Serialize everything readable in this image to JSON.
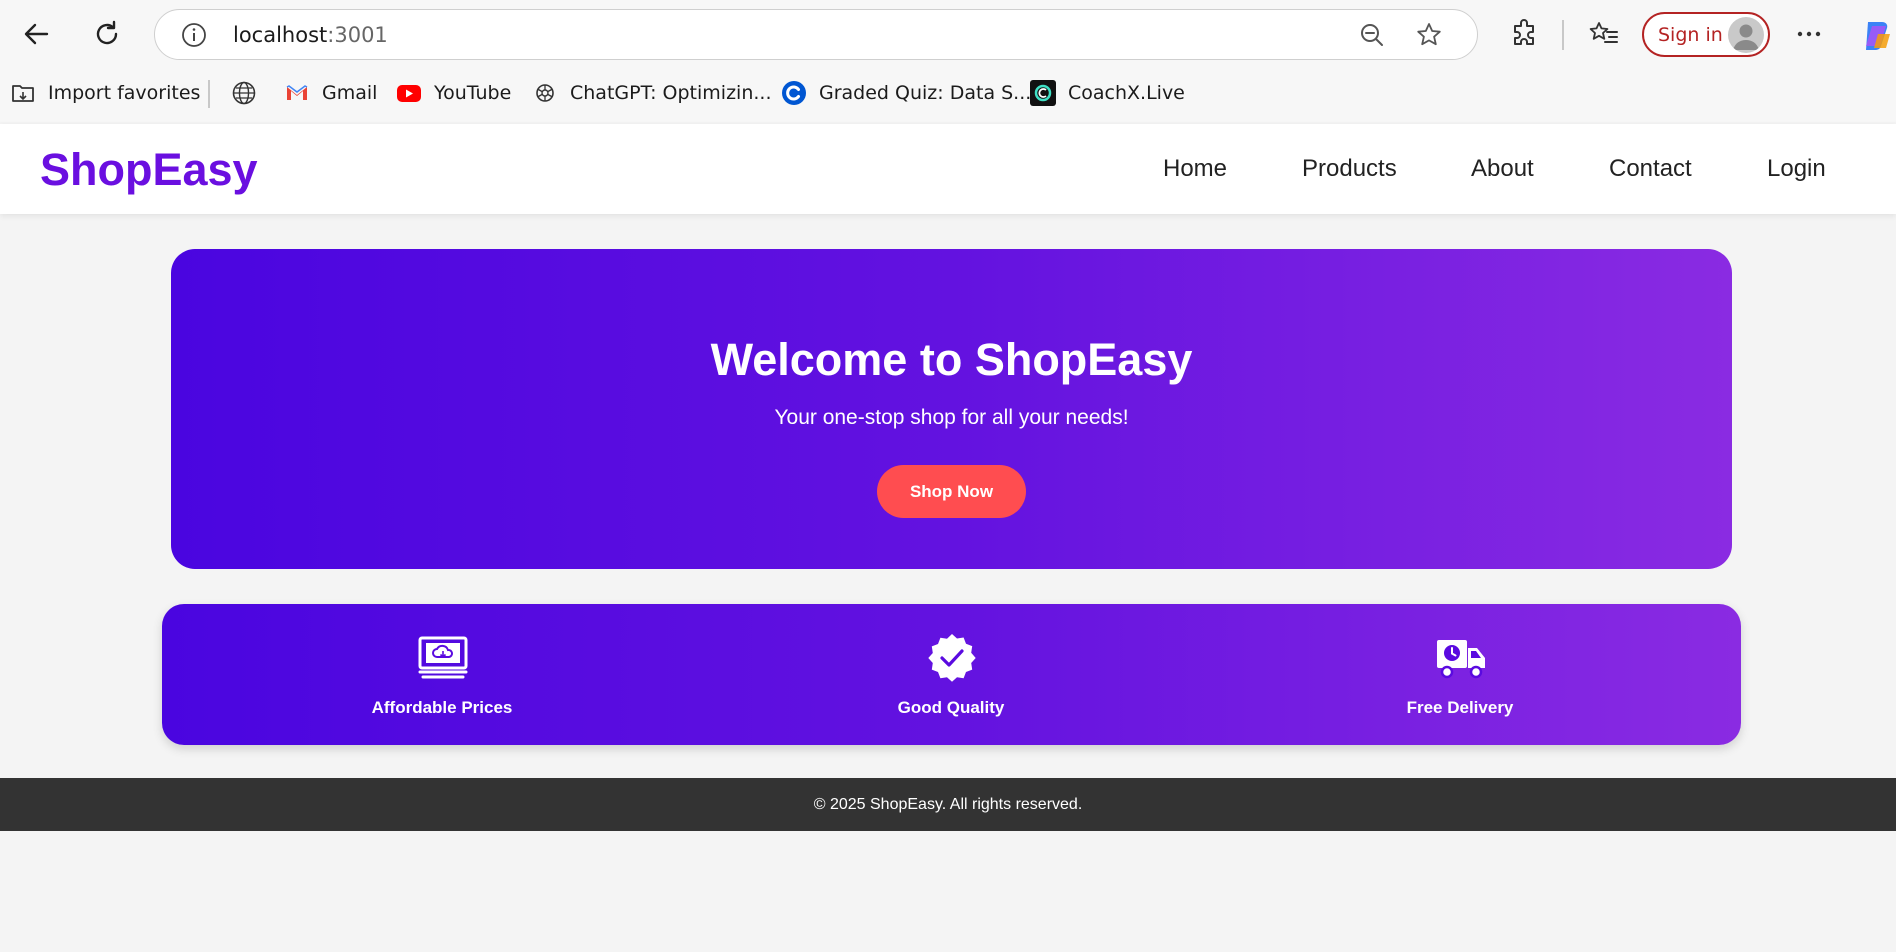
{
  "browser": {
    "url_host": "localhost",
    "url_port": ":3001",
    "sign_in_label": "Sign in",
    "bookmarks": [
      {
        "label": "Import favorites",
        "icon": "import-favorites-icon"
      },
      {
        "label": "",
        "icon": "globe-icon"
      },
      {
        "label": "Gmail",
        "icon": "gmail-icon"
      },
      {
        "label": "YouTube",
        "icon": "youtube-icon"
      },
      {
        "label": "ChatGPT: Optimizin...",
        "icon": "chatgpt-icon"
      },
      {
        "label": "Graded Quiz: Data S...",
        "icon": "coursera-icon"
      },
      {
        "label": "CoachX.Live",
        "icon": "coachx-icon"
      }
    ],
    "colors": {
      "sign_in": "#b42323"
    }
  },
  "site": {
    "logo": "ShopEasy",
    "nav": [
      "Home",
      "Products",
      "About",
      "Contact",
      "Login"
    ],
    "colors": {
      "brand": "#6a0fe0",
      "cta": "#ff4d50",
      "gradient_start": "#4a05e0",
      "gradient_end": "#8a2be2",
      "footer_bg": "#333333"
    }
  },
  "hero": {
    "title": "Welcome to ShopEasy",
    "subtitle": "Your one-stop shop for all your needs!",
    "cta_label": "Shop Now"
  },
  "features": [
    {
      "label": "Affordable Prices",
      "icon": "money-icon"
    },
    {
      "label": "Good Quality",
      "icon": "quality-badge-icon"
    },
    {
      "label": "Free Delivery",
      "icon": "delivery-truck-icon"
    }
  ],
  "footer": {
    "text": "© 2025 ShopEasy. All rights reserved."
  }
}
